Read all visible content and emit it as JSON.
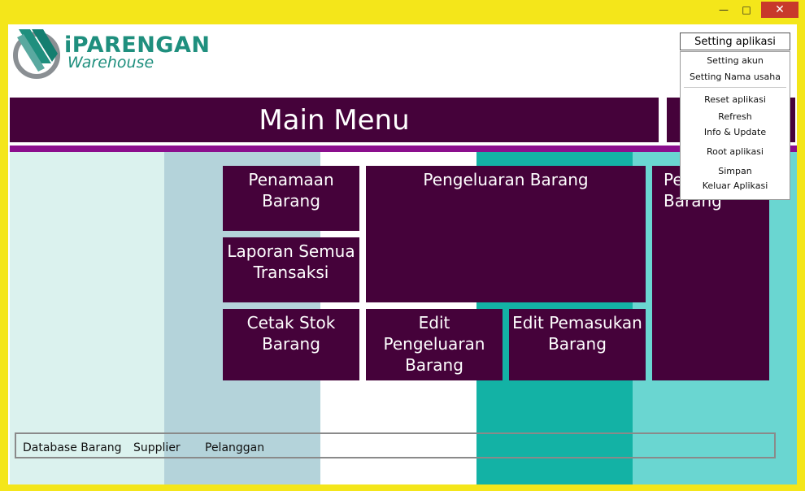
{
  "window": {
    "minimize_glyph": "—",
    "maximize_glyph": "□",
    "close_glyph": "✕"
  },
  "logo": {
    "title": "iPARENGAN",
    "subtitle": "Warehouse"
  },
  "main_menu": {
    "title": "Main Menu"
  },
  "tiles": {
    "penamaan_barang": "Penamaan Barang",
    "pengeluaran_barang": "Pengeluaran Barang",
    "pemasukan_barang": "Pemasukan Barang",
    "laporan_semua_transaksi": "Laporan Semua Transaksi",
    "cetak_stok_barang": "Cetak Stok Barang",
    "edit_pengeluaran_barang": "Edit Pengeluaran Barang",
    "edit_pemasukan_barang": "Edit Pemasukan Barang"
  },
  "bottom_tabs": [
    "Database Barang",
    "Supplier",
    "Pelanggan"
  ],
  "settings": {
    "button_label": "Setting aplikasi",
    "items": [
      "Setting akun",
      "Setting Nama usaha",
      "Reset aplikasi",
      "Refresh",
      "Info & Update",
      "Root aplikasi",
      "Simpan",
      "Keluar Aplikasi"
    ]
  },
  "colors": {
    "tile": "#45023a",
    "accent": "#8b0e8d",
    "frame": "#f4e61a",
    "brand": "#1f8f7e"
  }
}
